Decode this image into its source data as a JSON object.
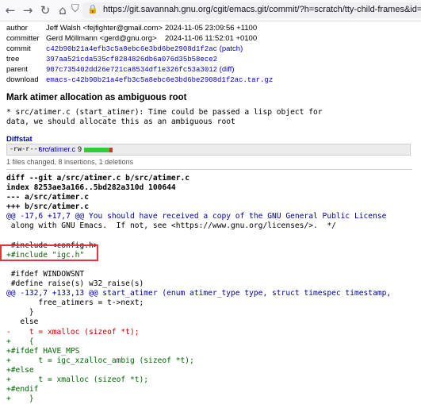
{
  "browser": {
    "url": "https://git.savannah.gnu.org/cgit/emacs.git/commit/?h=scratch/tty-child-frames&id=c"
  },
  "meta": [
    {
      "key": "author",
      "value": "Jeff Walsh <fejfighter@gmail.com>",
      "date": "2024-11-05 23:09:56 +1100",
      "mono": false,
      "link_text": ""
    },
    {
      "key": "committer",
      "value": "Gerd Möllmann <gerd@gnu.org>",
      "date": "2024-11-06 11:52:01 +0100",
      "mono": false,
      "link_text": ""
    },
    {
      "key": "commit",
      "value": "c42b90b21a4efb3c5a8ebc6e3bd6be2908d1f2ac",
      "date": "",
      "mono": true,
      "link_text": "(patch)"
    },
    {
      "key": "tree",
      "value": "397aa521cda535cf8284826db6a076d35b58ece2",
      "date": "",
      "mono": true,
      "link_text": ""
    },
    {
      "key": "parent",
      "value": "907c735402dd26e721ca8534df1e326fc53a3012",
      "date": "",
      "mono": true,
      "link_text": "(diff)"
    },
    {
      "key": "download",
      "value": "emacs-c42b90b21a4efb3c5a8ebc6e3bd6be2908d1f2ac.tar.gz",
      "date": "",
      "mono": true,
      "link_text": ""
    }
  ],
  "title": "Mark atimer allocation as ambiguous root",
  "message": [
    "* src/atimer.c (start_atimer): Time could be passed a lisp object for",
    "data, we should allocate this as an ambiguous root"
  ],
  "diffstat": {
    "heading": "Diffstat",
    "mode": "-rw-r--r--",
    "file": "src/atimer.c",
    "count": "9",
    "insertions": 8,
    "deletions": 1,
    "colors": {
      "add": "#33cc33",
      "del": "#cc3333"
    },
    "summary": "1 files changed, 8 insertions, 1 deletions"
  },
  "diff": [
    {
      "type": "bold",
      "text": "diff --git a/src/atimer.c b/src/atimer.c"
    },
    {
      "type": "bold",
      "text": "index 8253ae3a166..5bd282a310d 100644"
    },
    {
      "type": "bold",
      "text": "--- a/src/atimer.c"
    },
    {
      "type": "bold",
      "text": "+++ b/src/atimer.c"
    },
    {
      "type": "hunk",
      "text": "@@ -17,6 +17,7 @@ You should have received a copy of the GNU General Public License"
    },
    {
      "type": "ctx",
      "text": " along with GNU Emacs.  If not, see <https://www.gnu.org/licenses/>.  */"
    },
    {
      "type": "ctx",
      "text": ""
    },
    {
      "type": "ctx",
      "text": " #include <config.h>"
    },
    {
      "type": "add",
      "text": "+#include \"igc.h\""
    },
    {
      "type": "ctx",
      "text": ""
    },
    {
      "type": "ctx",
      "text": " #ifdef WINDOWSNT"
    },
    {
      "type": "ctx",
      "text": " #define raise(s) w32_raise(s)"
    },
    {
      "type": "hunk",
      "text": "@@ -132,7 +133,13 @@ start_atimer (enum atimer_type type, struct timespec timestamp,"
    },
    {
      "type": "ctx",
      "text": "       free_atimers = t->next;"
    },
    {
      "type": "ctx",
      "text": "     }"
    },
    {
      "type": "ctx",
      "text": "   else"
    },
    {
      "type": "del",
      "text": "-    t = xmalloc (sizeof *t);"
    },
    {
      "type": "add",
      "text": "+    {"
    },
    {
      "type": "add",
      "text": "+#ifdef HAVE_MPS"
    },
    {
      "type": "add",
      "text": "+      t = igc_xzalloc_ambig (sizeof *t);"
    },
    {
      "type": "add",
      "text": "+#else"
    },
    {
      "type": "add",
      "text": "+      t = xmalloc (sizeof *t);"
    },
    {
      "type": "add",
      "text": "+#endif"
    },
    {
      "type": "add",
      "text": "+    }"
    }
  ],
  "icons": {
    "back": "back-arrow-icon",
    "forward": "forward-arrow-icon",
    "reload": "reload-icon",
    "home": "home-icon",
    "shield": "tracking-shield-icon",
    "lock": "lock-icon"
  },
  "highlight_color": "#e8323c"
}
